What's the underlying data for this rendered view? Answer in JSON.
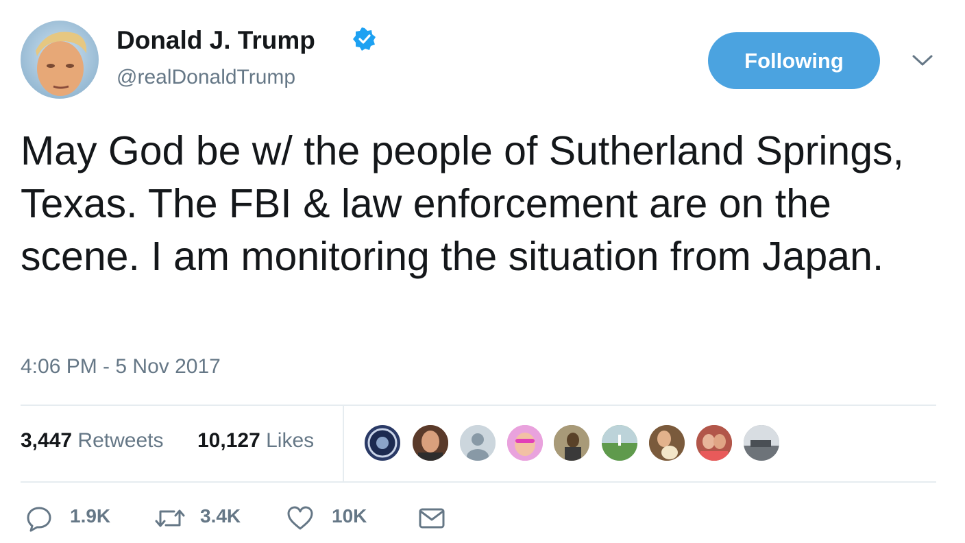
{
  "user": {
    "name": "Donald J. Trump",
    "handle": "@realDonaldTrump",
    "verified_color": "#1da1f2"
  },
  "follow_button": {
    "label": "Following",
    "color": "#4ba3e0"
  },
  "tweet": {
    "text": "May God be w/ the people of Sutherland Springs, Texas. The FBI & law enforcement are on the scene. I am monitoring the situation from Japan.",
    "timestamp": "4:06 PM - 5 Nov 2017"
  },
  "stats": {
    "retweets_count": "3,447",
    "retweets_label": "Retweets",
    "likes_count": "10,127",
    "likes_label": "Likes"
  },
  "liker_avatars": [
    "seal-avatar",
    "man-avatar",
    "default-avatar",
    "pink-avatar",
    "woman-avatar",
    "field-avatar",
    "dog-avatar",
    "couple-avatar",
    "landscape-avatar"
  ],
  "actions": {
    "reply_count": "1.9K",
    "retweet_count": "3.4K",
    "like_count": "10K"
  }
}
